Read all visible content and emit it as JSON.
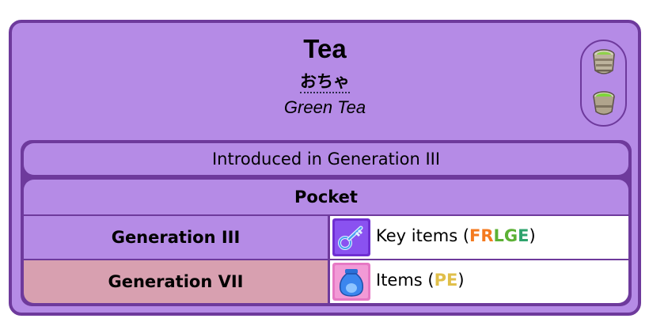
{
  "item": {
    "name": "Tea",
    "japanese": "おちゃ",
    "romaji": "Green Tea"
  },
  "intro": "Introduced in Generation III",
  "pocket": {
    "header": "Pocket",
    "rows": [
      {
        "generation": "Generation III",
        "label": "Key items",
        "games": [
          {
            "text": "FR",
            "color": "#f47a1f"
          },
          {
            "text": "LG",
            "color": "#5cb135"
          },
          {
            "text": "E",
            "color": "#2ea36d"
          }
        ],
        "icon": "key-items-pocket-icon",
        "icon_bg": "#6f2fd2"
      },
      {
        "generation": "Generation VII",
        "label": "Items",
        "games": [
          {
            "text": "PE",
            "color": "#e0bf4a"
          }
        ],
        "icon": "items-pocket-icon",
        "icon_bg": "#e678c4"
      }
    ]
  },
  "colors": {
    "card_bg": "#b58be6",
    "border": "#6e3a9c",
    "gen7_bg": "#d8a0b0"
  }
}
